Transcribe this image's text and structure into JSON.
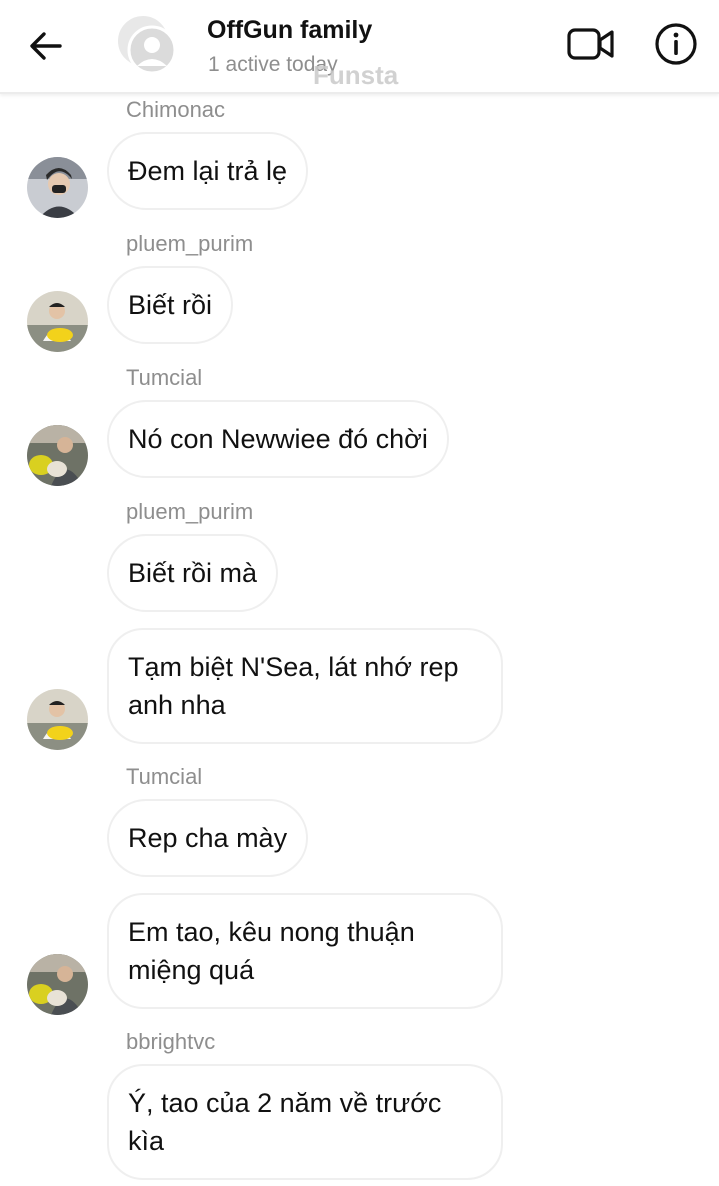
{
  "header": {
    "title": "OffGun family",
    "status": "1 active today",
    "watermark": "Funsta",
    "icons": {
      "back": "arrow-left-icon",
      "video": "video-camera-icon",
      "info": "info-icon"
    }
  },
  "messages": [
    {
      "sender": "Chimonac",
      "text": "Đem lại trả lẹ"
    },
    {
      "sender": "pluem_purim",
      "text": "Biết rồi"
    },
    {
      "sender": "Tumcial",
      "text": "Nó con Newwiee đó chời"
    },
    {
      "sender": "pluem_purim",
      "text": "Biết rồi mà"
    },
    {
      "sender": "",
      "text": "Tạm biệt N'Sea, lát nhớ rep anh nha"
    },
    {
      "sender": "Tumcial",
      "text": "Rep cha mày"
    },
    {
      "sender": "",
      "text": "Em tao, kêu nong thuận miệng quá"
    },
    {
      "sender": "bbrightvc",
      "text": "Ý, tao của 2 năm về trước kìa"
    }
  ],
  "colors": {
    "meta_text": "#8e8e8e",
    "bubble_border": "#efefef",
    "title_text": "#111111"
  }
}
